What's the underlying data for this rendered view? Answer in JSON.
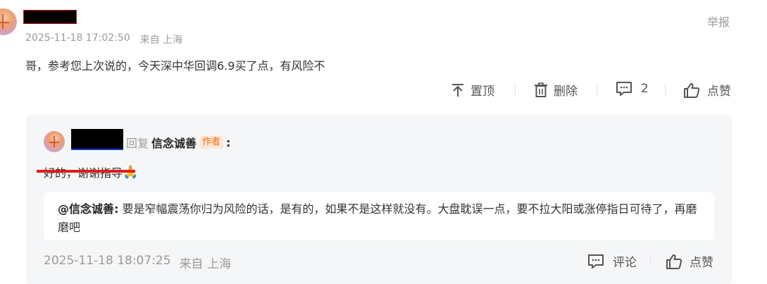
{
  "comment": {
    "timestamp": "2025-11-18 17:02:50",
    "location": "来自 上海",
    "report_label": "举报",
    "text": "哥，参考您上次说的，今天深中华回调6.9买了点，有风险不",
    "actions": {
      "pin_label": "置顶",
      "delete_label": "删除",
      "reply_count": "2",
      "like_label": "点赞"
    }
  },
  "reply": {
    "reply_word": "回复",
    "target_user": "信念诚善",
    "author_badge": "作者",
    "colon": ":",
    "text": "好的，谢谢指导",
    "emoji": "🙏",
    "quote_user": "@信念诚善:",
    "quote_text": "要是窄幅震荡你归为风险的话，是有的，如果不是这样就没有。大盘耽误一点，要不拉大阳或涨停指日可待了，再磨磨吧",
    "timestamp": "2025-11-18 18:07:25",
    "location": "来自 上海",
    "comment_label": "评论",
    "like_label": "点赞"
  },
  "colors": {
    "redaction": "#000000",
    "strike": "#e21b1b",
    "accent_badge": "#ff6a00",
    "reply_bg": "#f5f6f7"
  }
}
